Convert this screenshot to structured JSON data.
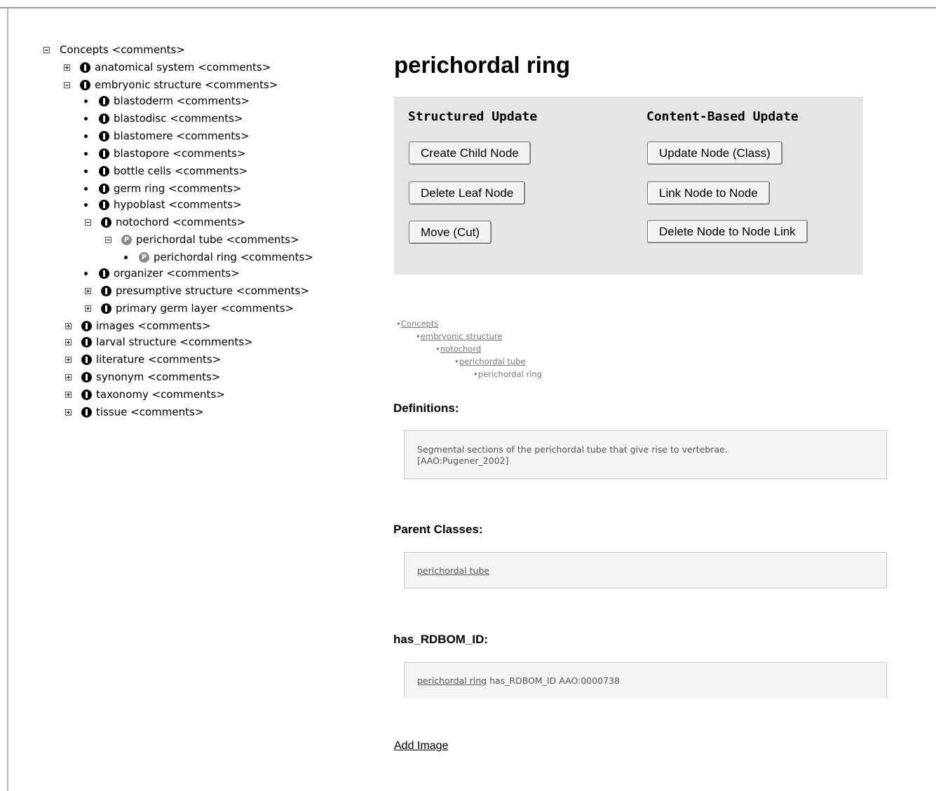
{
  "tree": {
    "root_label": "Concepts <comments>",
    "items": [
      {
        "label": "anatomical system <comments>"
      },
      {
        "label": "embryonic structure <comments>"
      },
      {
        "label": "blastoderm <comments>"
      },
      {
        "label": "blastodisc <comments>"
      },
      {
        "label": "blastomere <comments>"
      },
      {
        "label": "blastopore <comments>"
      },
      {
        "label": "bottle cells <comments>"
      },
      {
        "label": "germ ring <comments>"
      },
      {
        "label": "hypoblast <comments>"
      },
      {
        "label": "notochord <comments>"
      },
      {
        "label": "perichordal tube <comments>"
      },
      {
        "label": "perichordal ring <comments>"
      },
      {
        "label": "organizer <comments>"
      },
      {
        "label": "presumptive structure <comments>"
      },
      {
        "label": "primary germ layer <comments>"
      },
      {
        "label": "images <comments>"
      },
      {
        "label": "larval structure <comments>"
      },
      {
        "label": "literature <comments>"
      },
      {
        "label": "synonym <comments>"
      },
      {
        "label": "taxonomy <comments>"
      },
      {
        "label": "tissue <comments>"
      }
    ],
    "class_icon_glyph": "",
    "property_icon_glyph": "P"
  },
  "page_title": "perichordal ring",
  "update_panel": {
    "structured_heading": "Structured Update",
    "content_heading": "Content-Based Update",
    "create_child": "Create Child Node",
    "delete_leaf": "Delete Leaf Node",
    "move_cut": "Move (Cut)",
    "update_node": "Update Node (Class)",
    "link_node": "Link Node to Node",
    "delete_link": "Delete Node to Node Link"
  },
  "breadcrumb": {
    "bullet": "•",
    "items": [
      "Concepts",
      "embryonic structure",
      "notochord",
      "perichordal tube",
      "perichordal ring"
    ]
  },
  "definitions": {
    "heading": "Definitions:",
    "line1": "Segmental sections of the perichordal tube that give rise to vertebrae.",
    "line2": "[AAO:Pugener_2002]"
  },
  "parent_classes": {
    "heading": "Parent Classes:",
    "link": "perichordal tube"
  },
  "rdbom": {
    "heading": "has_RDBOM_ID:",
    "link": "perichordal ring",
    "text": " has_RDBOM_ID AAO:0000738"
  },
  "add_image": "Add Image"
}
